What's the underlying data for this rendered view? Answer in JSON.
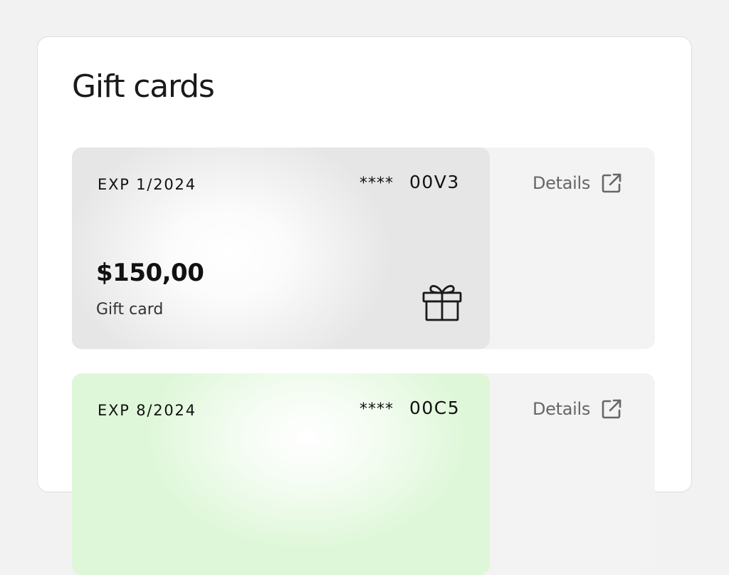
{
  "page": {
    "title": "Gift cards"
  },
  "cards": [
    {
      "exp": "EXP 1/2024",
      "mask": "****",
      "last4": "00V3",
      "amount": "$150,00",
      "type": "Gift card",
      "icon": "gift-icon",
      "details_label": "Details",
      "details_icon": "external-link-icon",
      "theme": "gray",
      "color": "#e6e6e6"
    },
    {
      "exp": "EXP 8/2024",
      "mask": "****",
      "last4": "00C5",
      "details_label": "Details",
      "details_icon": "external-link-icon",
      "theme": "green",
      "color": "#def7d8"
    }
  ]
}
